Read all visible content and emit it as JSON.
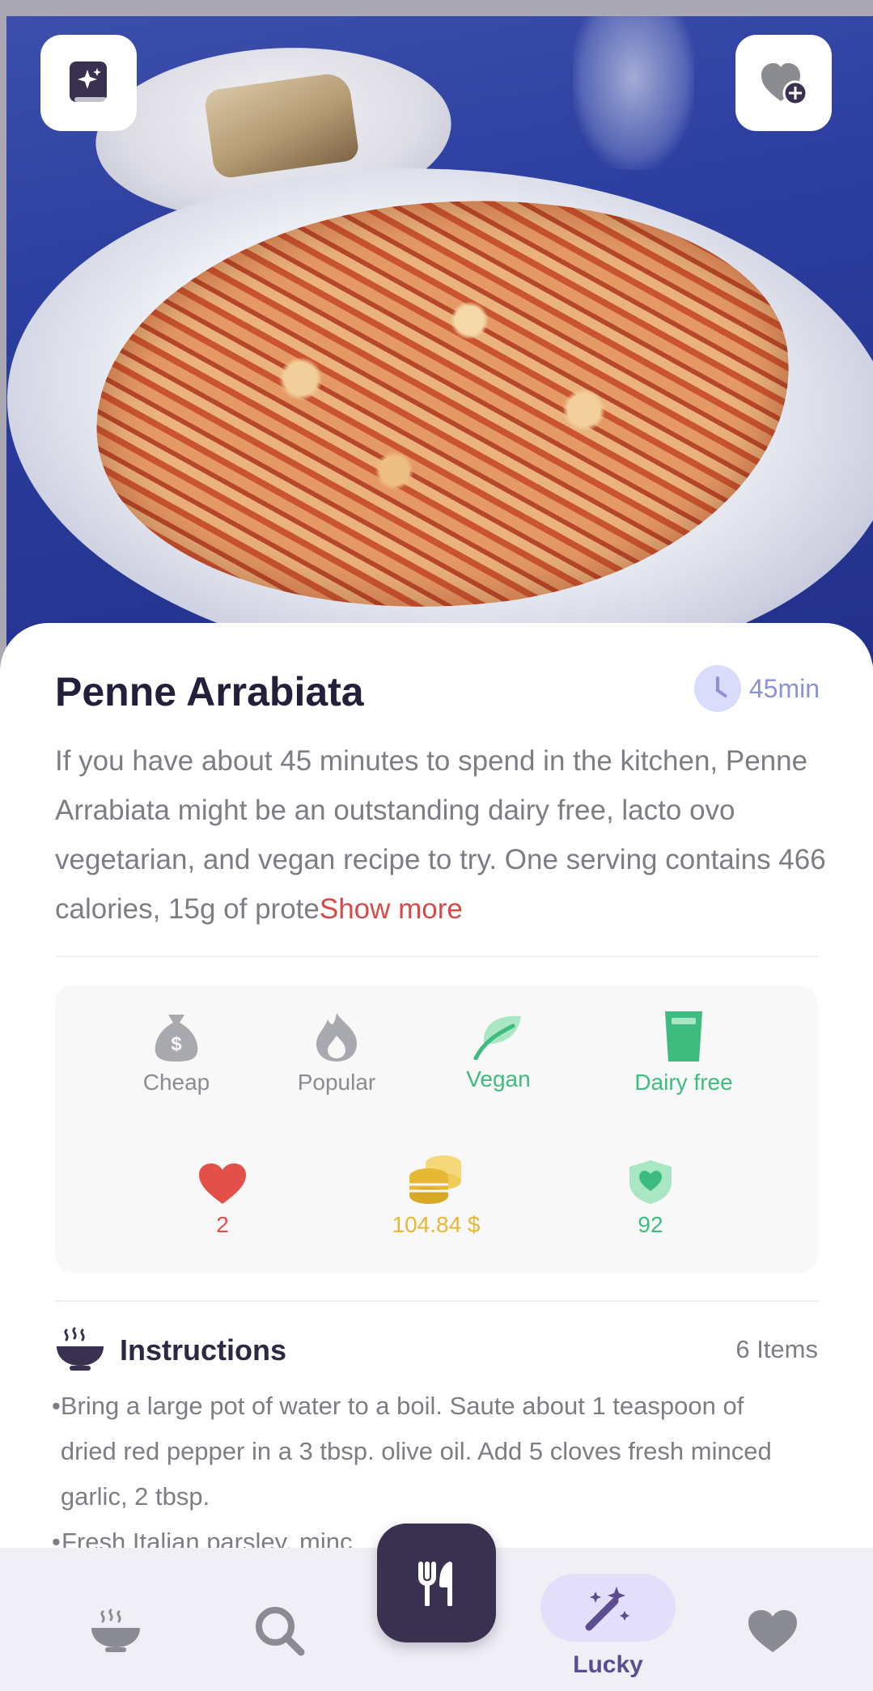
{
  "recipe": {
    "title": "Penne Arrabiata",
    "time": "45min",
    "description": "If you have about 45 minutes to spend in the kitchen, Penne Arrabiata might be an outstanding dairy free, lacto ovo vegetarian, and vegan recipe to try. One serving contains 466 calories, 15g of prote",
    "show_more": "Show more"
  },
  "hero": {
    "left_button_icon": "spark-book-icon",
    "right_button_icon": "heart-add-icon"
  },
  "tags": [
    {
      "label": "Cheap",
      "icon": "money-bag-icon",
      "active": false
    },
    {
      "label": "Popular",
      "icon": "flame-icon",
      "active": false
    },
    {
      "label": "Vegan",
      "icon": "leaf-icon",
      "active": true
    },
    {
      "label": "Dairy free",
      "icon": "glass-icon",
      "active": true
    }
  ],
  "metrics": [
    {
      "value": "2",
      "icon": "heart-icon",
      "color": "#e3504a"
    },
    {
      "value": "104.84 $",
      "icon": "coins-icon",
      "color": "#e6b836"
    },
    {
      "value": "92",
      "icon": "health-shield-icon",
      "color": "#3ebc7f"
    }
  ],
  "instructions": {
    "title": "Instructions",
    "count": "6 Items",
    "steps": [
      "Bring a large pot of water to a boil. Saute about 1 teaspoon of dried red pepper in a 3 tbsp. olive oil. Add 5 cloves fresh minced garlic, 2 tbsp.",
      "Fresh Italian parsley, minc"
    ]
  },
  "nav": {
    "items": [
      "bowl-icon",
      "search-icon",
      "fork-knife-icon",
      "magic-wand-icon",
      "heart-icon"
    ],
    "lucky_label": "Lucky"
  },
  "colors": {
    "accent": "#3a3050",
    "green": "#3ebc7f",
    "red": "#e3504a",
    "gold": "#e6b836",
    "lucky": "#5b4d8f"
  }
}
